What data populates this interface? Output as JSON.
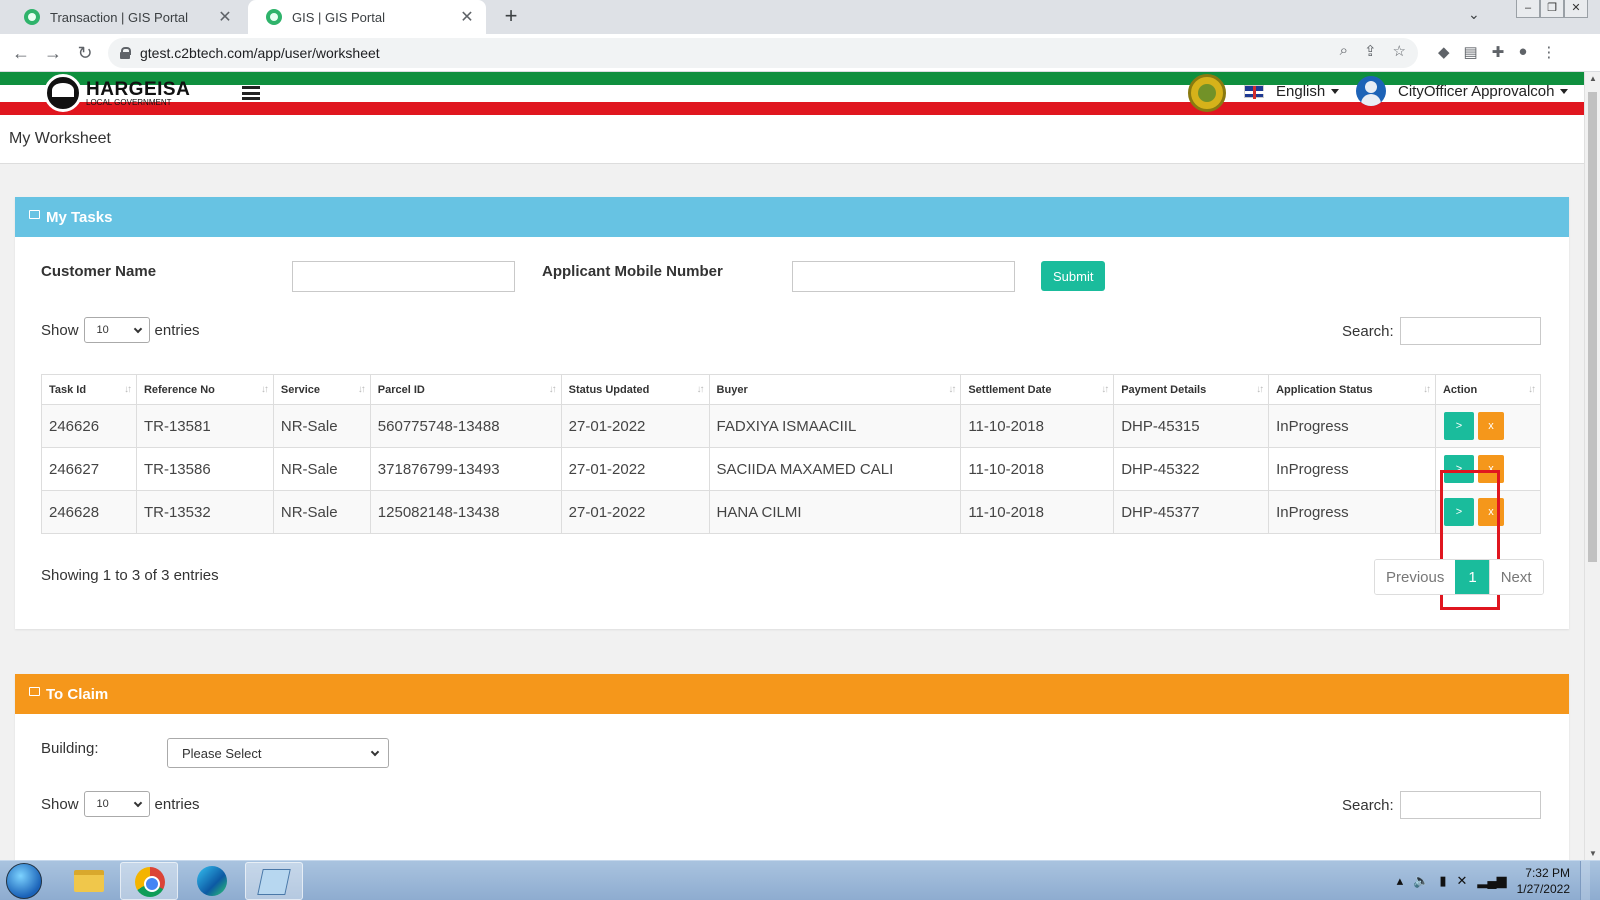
{
  "browser": {
    "tabs": [
      {
        "title": "Transaction | GIS Portal",
        "active": false
      },
      {
        "title": "GIS | GIS Portal",
        "active": true
      }
    ],
    "url": "gtest.c2btech.com/app/user/worksheet"
  },
  "header": {
    "logo_name": "HARGEISA",
    "logo_sub": "LOCAL GOVERNMENT",
    "language": "English",
    "user_name": "CityOfficer Approvalcoh"
  },
  "page": {
    "title": "My Worksheet"
  },
  "my_tasks": {
    "heading": "My Tasks",
    "customer_name_label": "Customer Name",
    "mobile_label": "Applicant Mobile Number",
    "submit_label": "Submit",
    "show_label": "Show",
    "entries_value": "10",
    "entries_label": "entries",
    "search_label": "Search:",
    "columns": [
      "Task Id",
      "Reference No",
      "Service",
      "Parcel ID",
      "Status Updated",
      "Buyer",
      "Settlement Date",
      "Payment Details",
      "Application Status",
      "Action"
    ],
    "rows": [
      {
        "task_id": "246626",
        "reference_no": "TR-13581",
        "service": "NR-Sale",
        "parcel_id": "560775748-13488",
        "status_updated": "27-01-2022",
        "buyer": "FADXIYA ISMAACIIL",
        "settlement_date": "11-10-2018",
        "payment_details": "DHP-45315",
        "application_status": "InProgress"
      },
      {
        "task_id": "246627",
        "reference_no": "TR-13586",
        "service": "NR-Sale",
        "parcel_id": "371876799-13493",
        "status_updated": "27-01-2022",
        "buyer": "SACIIDA MAXAMED CALI",
        "settlement_date": "11-10-2018",
        "payment_details": "DHP-45322",
        "application_status": "InProgress"
      },
      {
        "task_id": "246628",
        "reference_no": "TR-13532",
        "service": "NR-Sale",
        "parcel_id": "125082148-13438",
        "status_updated": "27-01-2022",
        "buyer": "HANA CILMI",
        "settlement_date": "11-10-2018",
        "payment_details": "DHP-45377",
        "application_status": "InProgress"
      }
    ],
    "action_go_label": ">",
    "action_cancel_label": "x",
    "info": "Showing 1 to 3 of 3 entries",
    "pager": {
      "previous": "Previous",
      "current": "1",
      "next": "Next"
    }
  },
  "to_claim": {
    "heading": "To Claim",
    "building_label": "Building:",
    "building_placeholder": "Please Select",
    "show_label": "Show",
    "entries_value": "10",
    "entries_label": "entries",
    "search_label": "Search:"
  },
  "taskbar": {
    "time": "7:32 PM",
    "date": "1/27/2022"
  },
  "colors": {
    "tasks_header": "#67c3e3",
    "claim_header": "#f5971b",
    "primary_button": "#1abc9c",
    "flag_green": "#0f8f3e",
    "flag_red": "#e0161f"
  }
}
